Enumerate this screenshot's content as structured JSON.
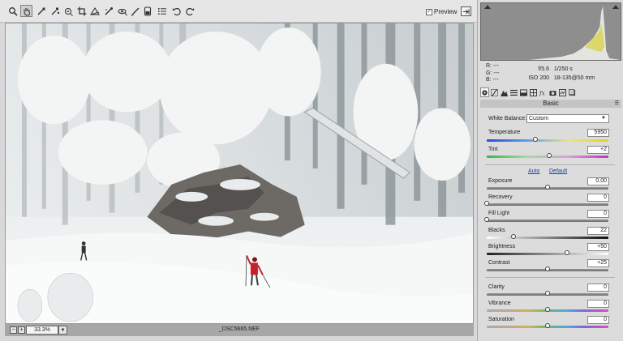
{
  "toolbar": {
    "tools": [
      {
        "name": "zoom-tool-icon"
      },
      {
        "name": "hand-tool-icon"
      },
      {
        "name": "white-balance-tool-icon"
      },
      {
        "name": "color-sampler-tool-icon"
      },
      {
        "name": "target-adjustment-tool-icon"
      },
      {
        "name": "crop-tool-icon"
      },
      {
        "name": "straighten-tool-icon"
      },
      {
        "name": "spot-removal-tool-icon"
      },
      {
        "name": "red-eye-tool-icon"
      },
      {
        "name": "adjustment-brush-icon"
      },
      {
        "name": "graduated-filter-icon"
      },
      {
        "name": "preferences-icon"
      },
      {
        "name": "rotate-left-icon"
      },
      {
        "name": "rotate-right-icon"
      }
    ],
    "preview_label": "Preview",
    "preview_checked": true
  },
  "status": {
    "zoom_out": "−",
    "zoom_in": "+",
    "zoom": "33.3%",
    "filename": "_DSC5665.NEF"
  },
  "info": {
    "r": "R:",
    "r_val": "---",
    "g": "G:",
    "g_val": "---",
    "b": "B:",
    "b_val": "---",
    "aperture": "f/5.6",
    "shutter": "1/250 s",
    "iso": "ISO 200",
    "lens": "18-135@50 mm"
  },
  "panel": {
    "section_title": "Basic",
    "white_balance_label": "White Balance:",
    "white_balance_value": "Custom",
    "auto_label": "Auto",
    "default_label": "Default",
    "sliders": {
      "temperature": {
        "label": "Temperature",
        "value": "5950",
        "fraction": 0.4
      },
      "tint": {
        "label": "Tint",
        "value": "+2",
        "fraction": 0.51
      },
      "exposure": {
        "label": "Exposure",
        "value": "0.00",
        "fraction": 0.5
      },
      "recovery": {
        "label": "Recovery",
        "value": "0",
        "fraction": 0.0
      },
      "fill_light": {
        "label": "Fill Light",
        "value": "0",
        "fraction": 0.0
      },
      "blacks": {
        "label": "Blacks",
        "value": "22",
        "fraction": 0.22
      },
      "brightness": {
        "label": "Brightness",
        "value": "+50",
        "fraction": 0.66
      },
      "contrast": {
        "label": "Contrast",
        "value": "+25",
        "fraction": 0.5
      },
      "clarity": {
        "label": "Clarity",
        "value": "0",
        "fraction": 0.5
      },
      "vibrance": {
        "label": "Vibrance",
        "value": "0",
        "fraction": 0.5
      },
      "saturation": {
        "label": "Saturation",
        "value": "0",
        "fraction": 0.5
      }
    }
  }
}
